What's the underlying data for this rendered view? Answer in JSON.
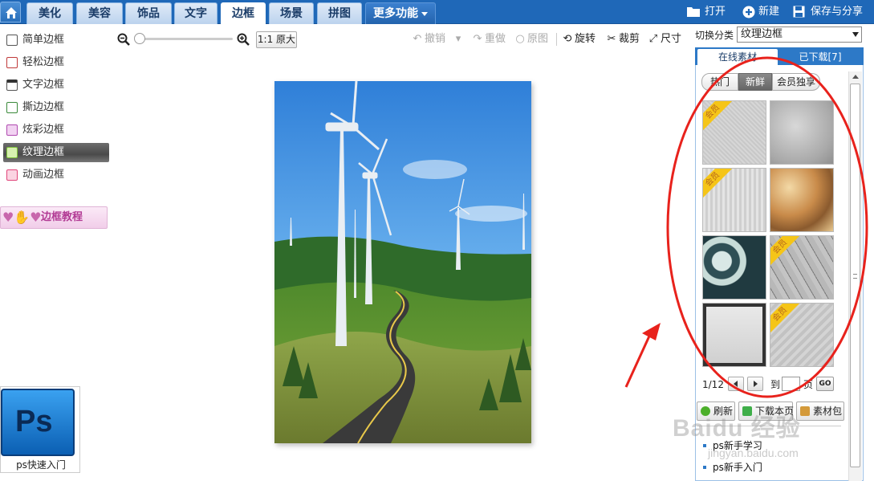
{
  "nav": {
    "tabs": [
      {
        "label": "美化"
      },
      {
        "label": "美容"
      },
      {
        "label": "饰品"
      },
      {
        "label": "文字"
      },
      {
        "label": "边框"
      },
      {
        "label": "场景"
      },
      {
        "label": "拼图"
      },
      {
        "label": "更多功能"
      }
    ],
    "active_tab": "边框",
    "actions": {
      "open": "打开",
      "new": "新建",
      "save_share": "保存与分享"
    }
  },
  "sidebar": {
    "items": [
      {
        "label": "简单边框"
      },
      {
        "label": "轻松边框"
      },
      {
        "label": "文字边框"
      },
      {
        "label": "撕边边框"
      },
      {
        "label": "炫彩边框"
      },
      {
        "label": "纹理边框"
      },
      {
        "label": "动画边框"
      }
    ],
    "active_item": "纹理边框",
    "tutorial_label": "边框教程",
    "ps_card_caption": "ps快速入门",
    "ps_logo_text": "Ps"
  },
  "toolbar": {
    "original_size": "1:1 原大",
    "undo": "撤销",
    "redo": "重做",
    "original": "原图",
    "rotate": "旋转",
    "crop": "裁剪",
    "size": "尺寸"
  },
  "right_panel": {
    "switch_label": "切换分类",
    "category_value": "纹理边框",
    "tabs": {
      "online": "在线素材",
      "downloaded": "已下载[7]"
    },
    "filters": {
      "hot": "热门",
      "new": "新鲜",
      "member": "会员独享"
    },
    "active_filter": "新鲜",
    "member_badge": "会员",
    "pagination": {
      "current": "1/12",
      "goto_label": "到",
      "page_label": "页",
      "go": "GO"
    },
    "buttons": {
      "refresh": "刷新",
      "download_page": "下载本页",
      "pack": "素材包"
    },
    "links": [
      {
        "label": "ps新手学习"
      },
      {
        "label": "ps新手入门"
      }
    ]
  },
  "colors": {
    "topbar": "#1f68b8",
    "annotation_red": "#e8221c",
    "tab_active_bg": "#ffffff"
  },
  "watermark": {
    "logo": "Baidu 经验",
    "url": "jingyan.baidu.com"
  }
}
